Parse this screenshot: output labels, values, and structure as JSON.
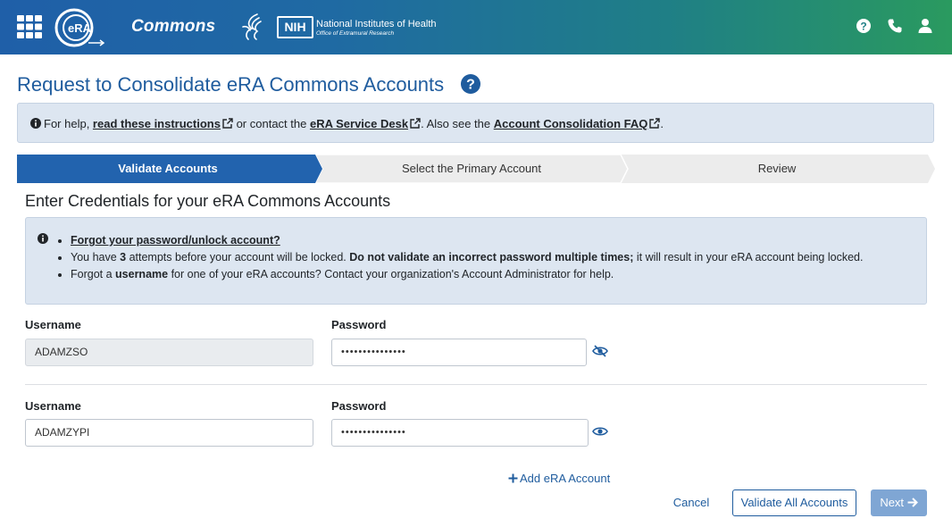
{
  "header": {
    "app_name": "Commons",
    "logo_text": "eRA",
    "nih_abbr": "NIH",
    "nih_name": "National Institutes of Health",
    "nih_office": "Office of Extramural Research",
    "icons": [
      "grid-menu-icon",
      "help-icon",
      "phone-icon",
      "user-icon"
    ],
    "gradient_colors": [
      "#1f5fa8",
      "#2a9a5f"
    ]
  },
  "page": {
    "title": "Request to Consolidate eRA Commons Accounts"
  },
  "help_banner": {
    "prefix": "For help, ",
    "link1": "read these instructions",
    "mid1": " or contact the ",
    "link2": "eRA Service Desk",
    "mid2": ". Also see the ",
    "link3": "Account Consolidation FAQ",
    "suffix": "."
  },
  "stepper": {
    "steps": [
      "Validate Accounts",
      "Select the Primary Account",
      "Review"
    ],
    "active_index": 0,
    "active_color": "#2263ae",
    "inactive_color": "#ececec"
  },
  "section": {
    "title": "Enter Credentials for your eRA Commons Accounts",
    "info": {
      "forgot_link": "Forgot your password/unlock account?",
      "attempts_pre": "You have ",
      "attempts_num": "3",
      "attempts_mid": " attempts before your account will be locked. ",
      "attempts_bold": "Do not validate an incorrect password multiple times;",
      "attempts_post": " it will result in your eRA account being locked.",
      "username_pre": "Forgot a ",
      "username_bold": "username",
      "username_post": " for one of your eRA accounts? Contact your organization's Account Administrator for help."
    }
  },
  "accounts": [
    {
      "username_label": "Username",
      "username": "ADAMZSO",
      "username_readonly": true,
      "password_label": "Password",
      "password_mask": "•••••••••••••••",
      "eye_icon": "eye-slash-icon"
    },
    {
      "username_label": "Username",
      "username": "ADAMZYPI",
      "username_readonly": false,
      "password_label": "Password",
      "password_mask": "•••••••••••••••",
      "eye_icon": "eye-icon"
    }
  ],
  "actions": {
    "add_account": "Add eRA Account",
    "cancel": "Cancel",
    "validate_all": "Validate All Accounts",
    "next": "Next"
  }
}
